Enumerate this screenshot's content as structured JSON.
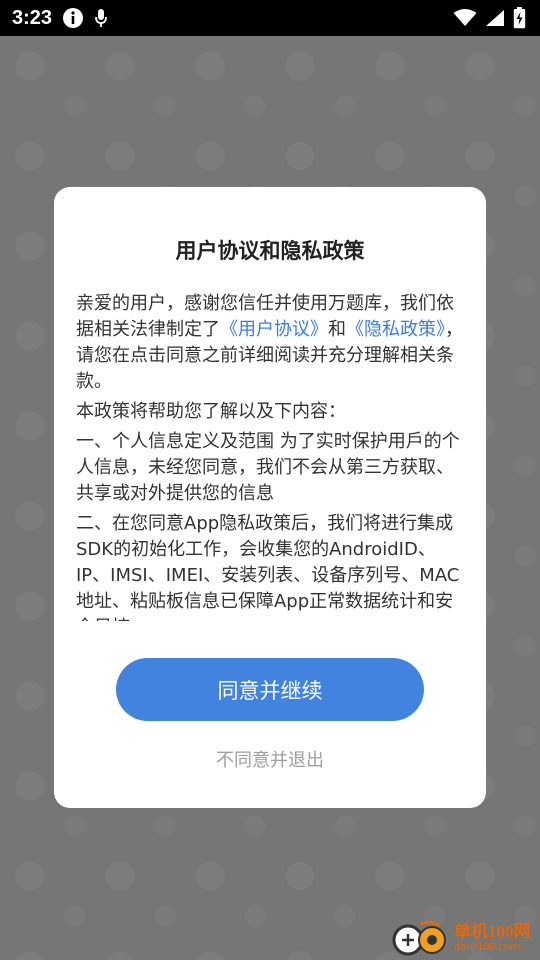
{
  "status_bar": {
    "time": "3:23",
    "icons": [
      "info-icon",
      "microphone-icon",
      "wifi-icon",
      "signal-icon",
      "battery-charging-icon"
    ]
  },
  "dialog": {
    "title": "用户协议和隐私政策",
    "p1_before": "亲爱的用户，感谢您信任并使用万题库，我们依据相关法律制定了",
    "link_agreement": "《用户协议》",
    "p1_and": "和",
    "link_privacy": "《隐私政策》",
    "p1_after": "，请您在点击同意之前详细阅读并充分理解相关条款。",
    "p2": "本政策将帮助您了解以及下内容：",
    "p3": "一、个人信息定义及范围 为了实时保护用戶的个人信息，未经您同意，我们不会从第三方获取、共享或对外提供您的信息",
    "p4": "二、在您同意App隐私政策后，我们将进行集成SDK的初始化工作，会收集您的AndroidID、IP、IMSI、IMEI、安装列表、设备序列号、MAC地址、粘贴板信息已保障App正常数据统计和安全风控。",
    "agree_button": "同意并继续",
    "decline_button": "不同意并退出"
  },
  "watermark": {
    "name": "单机100网",
    "url": "danji100.com"
  },
  "colors": {
    "accent": "#4283e0",
    "link": "#3b7be0",
    "overlay": "#757575",
    "watermark": "#e06a10"
  }
}
